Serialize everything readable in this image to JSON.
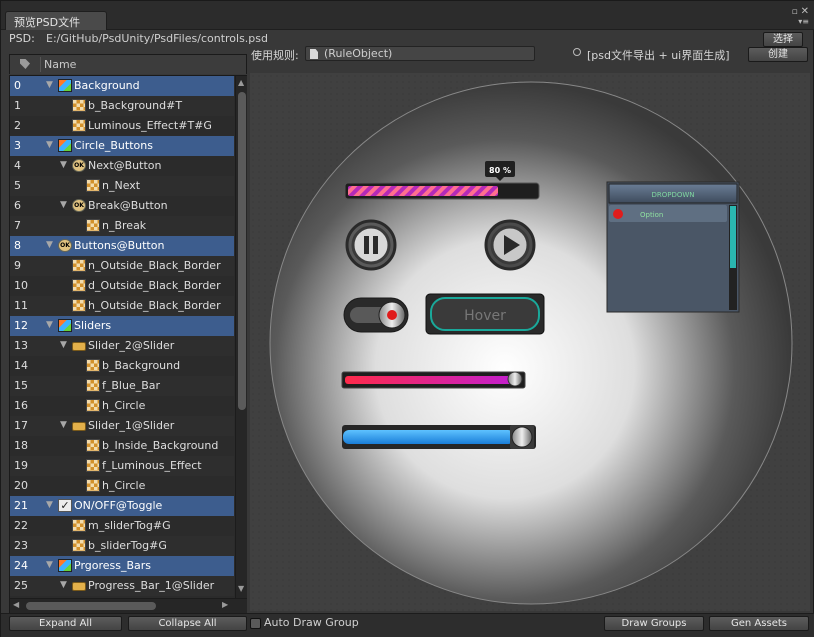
{
  "window": {
    "tab_title": "预览PSD文件"
  },
  "path": {
    "label": "PSD:",
    "value": "E:/GitHub/PsdUnity/PsdFiles/controls.psd",
    "select_button": "选择"
  },
  "rule": {
    "label": "使用规则:",
    "object_value": "(RuleObject)",
    "hint": "[psd文件导出 + ui界面生成]",
    "create_button": "创建"
  },
  "tree": {
    "header_name": "Name",
    "rows": [
      {
        "num": "0",
        "label": "Background",
        "icon": "cube-icon",
        "depth": 0,
        "arrow": true,
        "selected": true
      },
      {
        "num": "1",
        "label": "b_Background#T",
        "icon": "image-icon",
        "depth": 1,
        "arrow": false,
        "selected": false
      },
      {
        "num": "2",
        "label": "Luminous_Effect#T#G",
        "icon": "image-icon",
        "depth": 1,
        "arrow": false,
        "selected": false
      },
      {
        "num": "3",
        "label": "Circle_Buttons",
        "icon": "cube-icon",
        "depth": 0,
        "arrow": true,
        "selected": true
      },
      {
        "num": "4",
        "label": "Next@Button",
        "icon": "ok-button-icon",
        "depth": 1,
        "arrow": true,
        "selected": false
      },
      {
        "num": "5",
        "label": "n_Next",
        "icon": "image-icon",
        "depth": 2,
        "arrow": false,
        "selected": false
      },
      {
        "num": "6",
        "label": "Break@Button",
        "icon": "ok-button-icon",
        "depth": 1,
        "arrow": true,
        "selected": false
      },
      {
        "num": "7",
        "label": "n_Break",
        "icon": "image-icon",
        "depth": 2,
        "arrow": false,
        "selected": false
      },
      {
        "num": "8",
        "label": "Buttons@Button",
        "icon": "ok-button-icon",
        "depth": 0,
        "arrow": true,
        "selected": true
      },
      {
        "num": "9",
        "label": "n_Outside_Black_Border",
        "icon": "image-icon",
        "depth": 1,
        "arrow": false,
        "selected": false
      },
      {
        "num": "10",
        "label": "d_Outside_Black_Border",
        "icon": "image-icon",
        "depth": 1,
        "arrow": false,
        "selected": false
      },
      {
        "num": "11",
        "label": "h_Outside_Black_Border",
        "icon": "image-icon",
        "depth": 1,
        "arrow": false,
        "selected": false
      },
      {
        "num": "12",
        "label": "Sliders",
        "icon": "cube-icon",
        "depth": 0,
        "arrow": true,
        "selected": true
      },
      {
        "num": "13",
        "label": "Slider_2@Slider",
        "icon": "slider-icon",
        "depth": 1,
        "arrow": true,
        "selected": false
      },
      {
        "num": "14",
        "label": "b_Background",
        "icon": "image-icon",
        "depth": 2,
        "arrow": false,
        "selected": false
      },
      {
        "num": "15",
        "label": "f_Blue_Bar",
        "icon": "image-icon",
        "depth": 2,
        "arrow": false,
        "selected": false
      },
      {
        "num": "16",
        "label": "h_Circle",
        "icon": "image-icon",
        "depth": 2,
        "arrow": false,
        "selected": false
      },
      {
        "num": "17",
        "label": "Slider_1@Slider",
        "icon": "slider-icon",
        "depth": 1,
        "arrow": true,
        "selected": false
      },
      {
        "num": "18",
        "label": "b_Inside_Background",
        "icon": "image-icon",
        "depth": 2,
        "arrow": false,
        "selected": false
      },
      {
        "num": "19",
        "label": "f_Luminous_Effect",
        "icon": "image-icon",
        "depth": 2,
        "arrow": false,
        "selected": false
      },
      {
        "num": "20",
        "label": "h_Circle",
        "icon": "image-icon",
        "depth": 2,
        "arrow": false,
        "selected": false
      },
      {
        "num": "21",
        "label": "ON/OFF@Toggle",
        "icon": "checkbox-icon",
        "depth": 0,
        "arrow": true,
        "selected": true
      },
      {
        "num": "22",
        "label": "m_sliderTog#G",
        "icon": "image-icon",
        "depth": 1,
        "arrow": false,
        "selected": false
      },
      {
        "num": "23",
        "label": "b_sliderTog#G",
        "icon": "image-icon",
        "depth": 1,
        "arrow": false,
        "selected": false
      },
      {
        "num": "24",
        "label": "Prgoress_Bars",
        "icon": "cube-icon",
        "depth": 0,
        "arrow": true,
        "selected": true
      },
      {
        "num": "25",
        "label": "Progress_Bar_1@Slider",
        "icon": "slider-icon",
        "depth": 1,
        "arrow": true,
        "selected": false
      }
    ]
  },
  "preview": {
    "progress_label": "80 %",
    "progress_fraction": 0.8,
    "hover_label": "Hover",
    "dropdown_header": "DROPDOWN",
    "dropdown_option": "Option",
    "slider_red_fraction": 0.97,
    "slider_blue_fraction": 0.9
  },
  "bottom": {
    "expand_all": "Expand All",
    "collapse_all": "Collapse All",
    "auto_draw_group": "Auto Draw Group",
    "draw_groups": "Draw Groups",
    "gen_assets": "Gen Assets"
  }
}
